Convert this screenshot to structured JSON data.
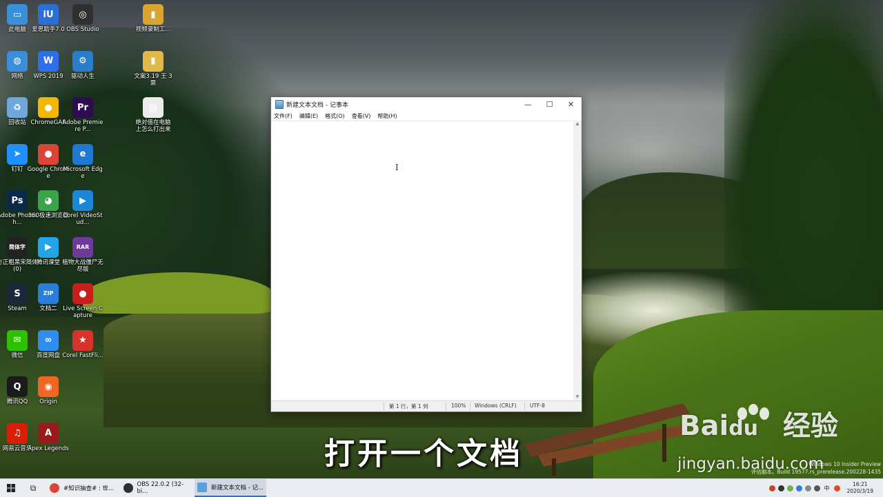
{
  "desktop": {
    "icons": [
      {
        "label": "此电脑",
        "glyph": "▭",
        "color": "#3a8fd8"
      },
      {
        "label": "爱思助手7.0",
        "glyph": "iU",
        "color": "#2b6fd6"
      },
      {
        "label": "OBS Studio",
        "glyph": "◎",
        "color": "#303030"
      },
      {
        "label": "视频录制工...",
        "glyph": "▮",
        "color": "#d9a531"
      },
      {
        "label": "网络",
        "glyph": "◍",
        "color": "#3a8fd8"
      },
      {
        "label": "WPS 2019",
        "glyph": "W",
        "color": "#2f6ee8"
      },
      {
        "label": "驱动人生",
        "glyph": "⚙",
        "color": "#2a7dc9"
      },
      {
        "label": "文案3.19 王 3票",
        "glyph": "▮",
        "color": "#e0b84c"
      },
      {
        "label": "回收站",
        "glyph": "♻",
        "color": "#6fa8dc"
      },
      {
        "label": "ChromeGAE",
        "glyph": "●",
        "color": "#f2b705"
      },
      {
        "label": "Adobe Premiere P...",
        "glyph": "Pr",
        "color": "#2d0d4f"
      },
      {
        "label": "绝对值在电脑 上怎么打出来",
        "glyph": "▤",
        "color": "#ececec"
      },
      {
        "label": "钉钉",
        "glyph": "➤",
        "color": "#1e90ff"
      },
      {
        "label": "Google Chrome",
        "glyph": "●",
        "color": "#db4437"
      },
      {
        "label": "Microsoft Edge",
        "glyph": "e",
        "color": "#1f78d1"
      },
      {
        "label": "Adobe Photosh...",
        "glyph": "Ps",
        "color": "#0b2a4a"
      },
      {
        "label": "360极速浏览器",
        "glyph": "◕",
        "color": "#3aa34b"
      },
      {
        "label": "Corel VideoStud...",
        "glyph": "▶",
        "color": "#1c87d9"
      },
      {
        "label": "方正粗黑宋简体(0)",
        "glyph": "简体字",
        "color": "#222222"
      },
      {
        "label": "腾讯课堂",
        "glyph": "▶",
        "color": "#23a3e8"
      },
      {
        "label": "植物大战僵尸无尽版",
        "glyph": "RAR",
        "color": "#6b3a9b"
      },
      {
        "label": "Steam",
        "glyph": "S",
        "color": "#1b2838"
      },
      {
        "label": "文档二",
        "glyph": "ZIP",
        "color": "#2a7dd8"
      },
      {
        "label": "Live Screen Capture",
        "glyph": "●",
        "color": "#c81e1e"
      },
      {
        "label": "微信",
        "glyph": "✉",
        "color": "#2dc100"
      },
      {
        "label": "百度网盘",
        "glyph": "∞",
        "color": "#2f8ef0"
      },
      {
        "label": "Corel FastFli...",
        "glyph": "★",
        "color": "#d8332b"
      },
      {
        "label": "腾讯QQ",
        "glyph": "Q",
        "color": "#1a1a1a"
      },
      {
        "label": "Origin",
        "glyph": "◉",
        "color": "#f06424"
      },
      {
        "label": "网易云音乐",
        "glyph": "♫",
        "color": "#d81e06"
      },
      {
        "label": "Apex Legends",
        "glyph": "A",
        "color": "#9a1b1b"
      }
    ]
  },
  "notepad": {
    "title": "新建文本文档 - 记事本",
    "menu": [
      "文件(F)",
      "编辑(E)",
      "格式(O)",
      "查看(V)",
      "帮助(H)"
    ],
    "controls": {
      "minimize": "—",
      "maximize": "☐",
      "close": "✕"
    },
    "status": {
      "position": "第 1 行，第 1 列",
      "zoom": "100%",
      "line_ending": "Windows (CRLF)",
      "encoding": "UTF-8"
    },
    "cursor_glyph": "I"
  },
  "caption": "打开一个文档",
  "watermark": {
    "brand_prefix": "Bai",
    "brand_suffix": "du",
    "product": "经验",
    "url": "jingyan.baidu.com"
  },
  "insider": {
    "line1": "Windows 10 Insider Preview",
    "line2": "评估副本。Build 19577.rs_prerelease.200228-1435"
  },
  "taskbar": {
    "apps": [
      {
        "label": "#知识抽查# : 世...",
        "color": "#db4437"
      },
      {
        "label": "OBS 22.0.2 (32-bi...",
        "color": "#303030"
      },
      {
        "label": "新建文本文档 - 记...",
        "color": "#5aa0d8"
      }
    ],
    "tray_lang": "中",
    "time": "16:21",
    "date": "2020/3/19"
  }
}
